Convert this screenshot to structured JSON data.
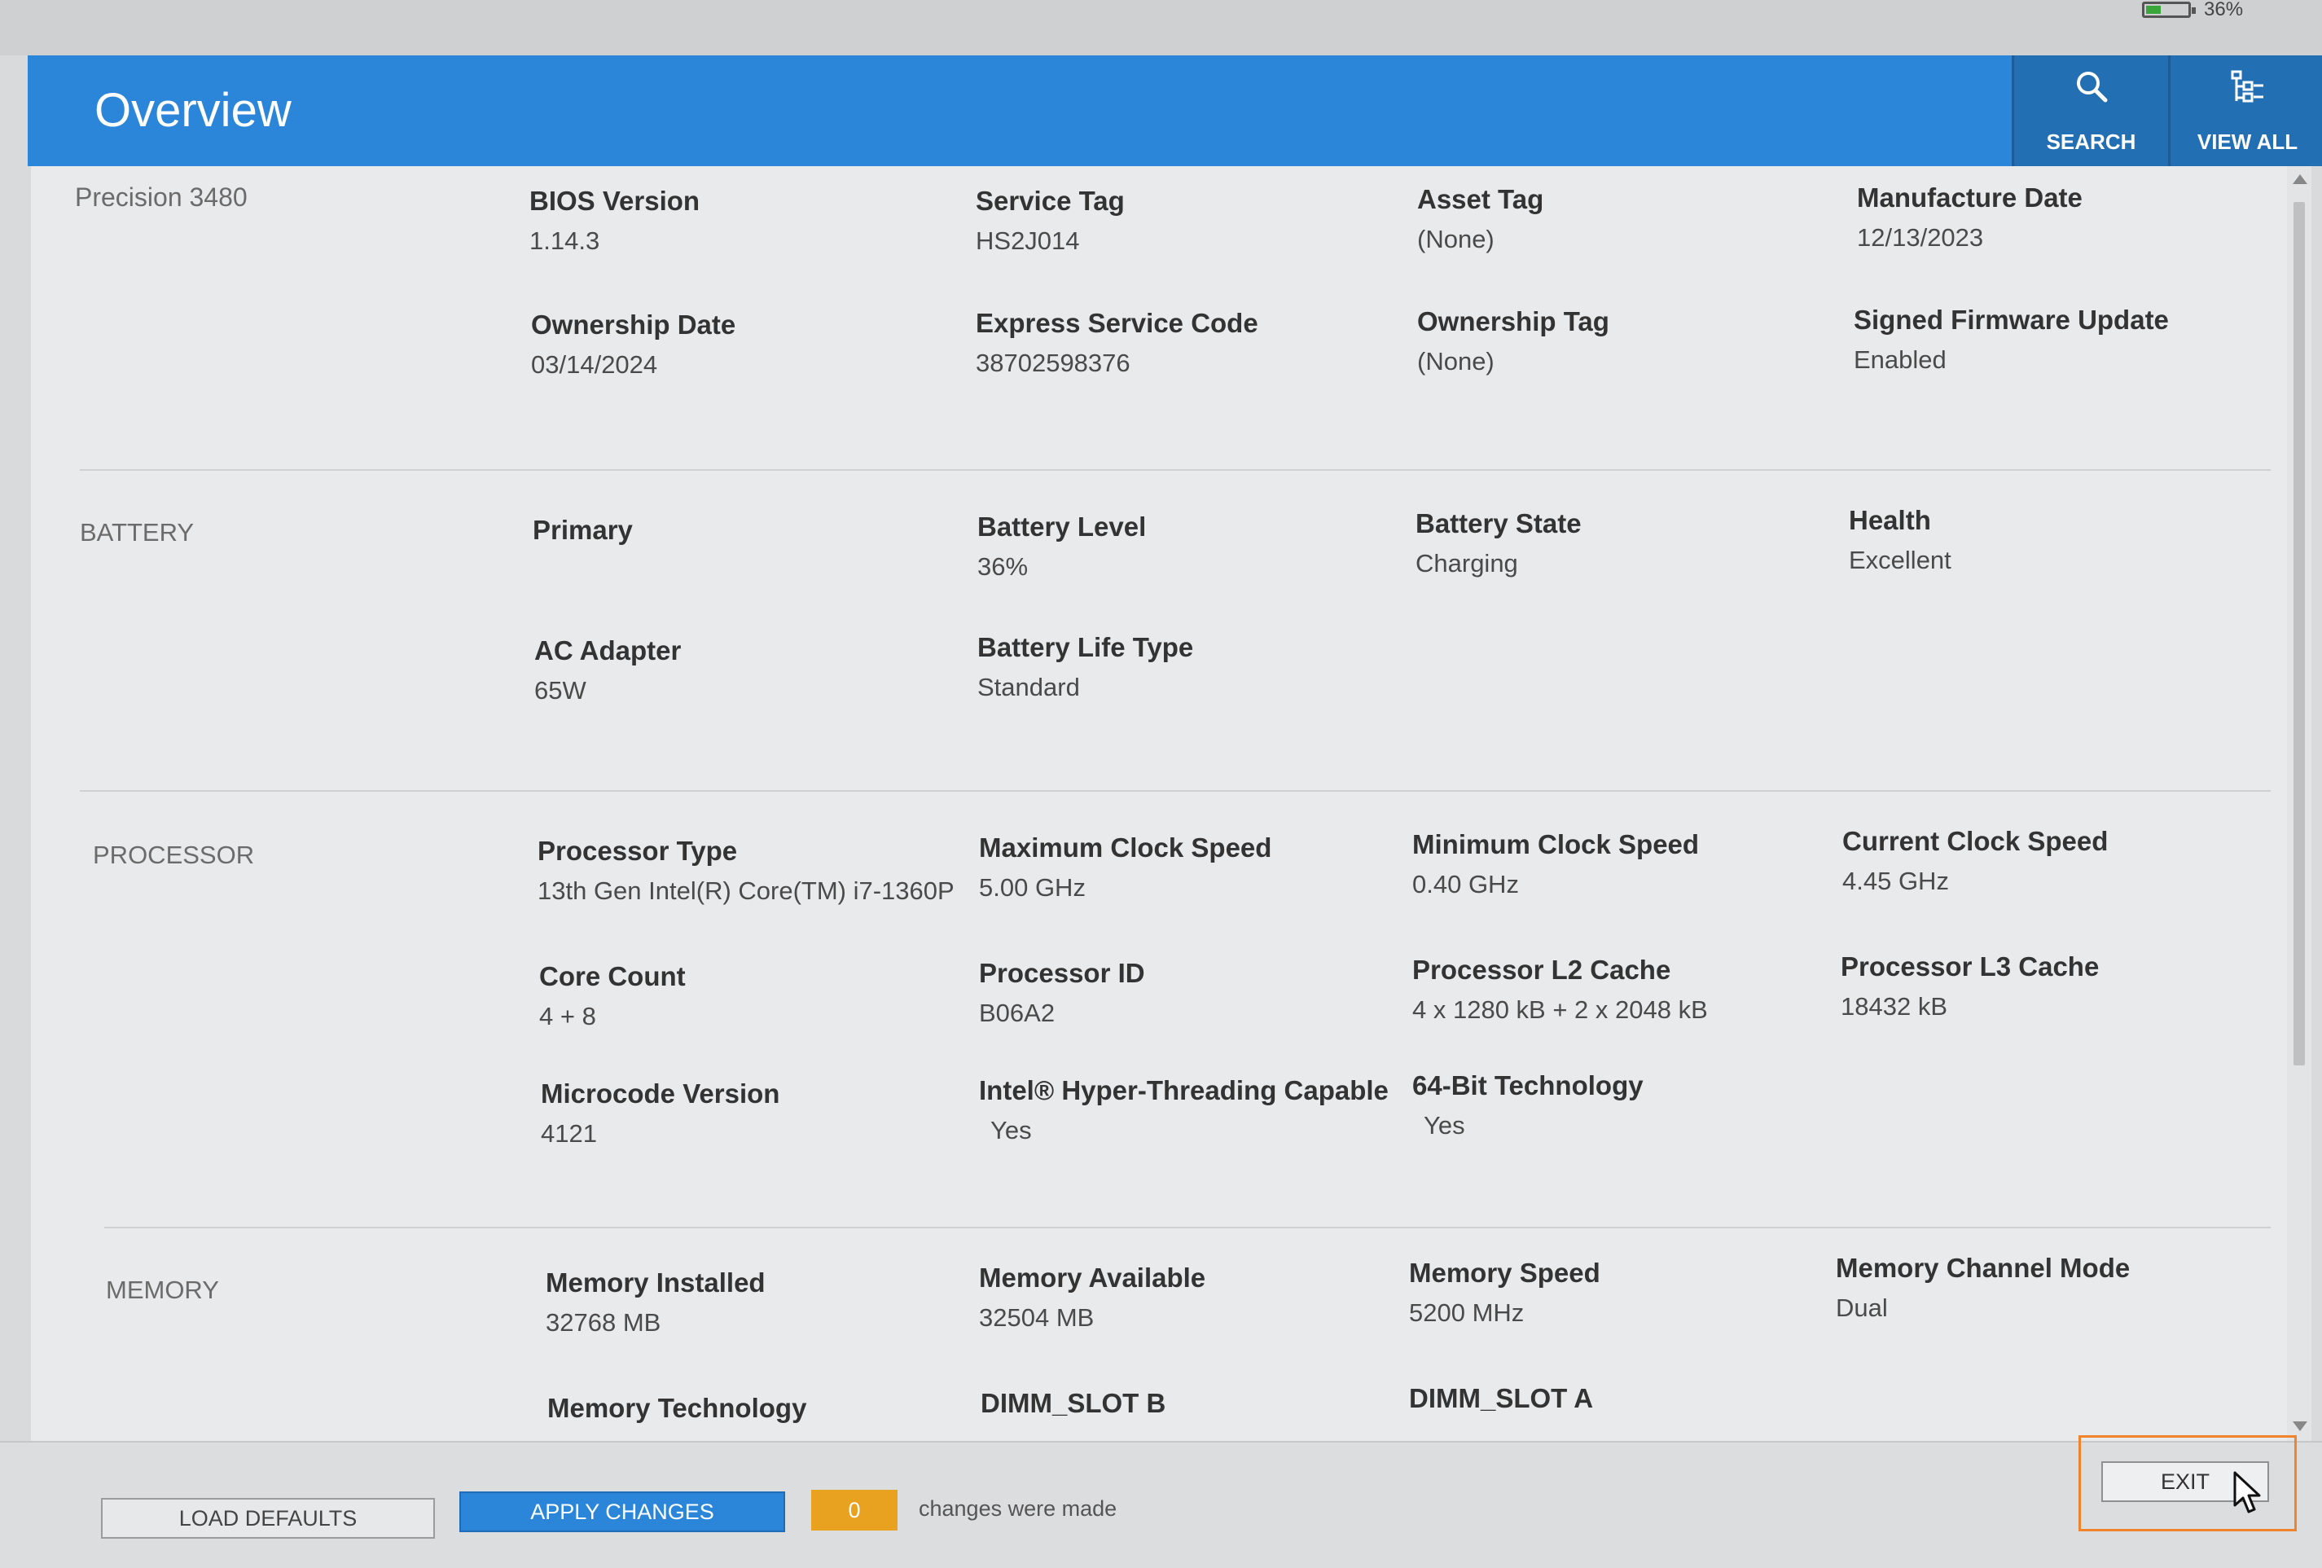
{
  "status": {
    "battery_percent": "36%",
    "battery_level": 0.36
  },
  "header": {
    "title": "Overview",
    "search_label": "SEARCH",
    "viewall_label": "VIEW ALL"
  },
  "system": {
    "model": "Precision 3480",
    "fields": [
      {
        "label": "BIOS Version",
        "value": "1.14.3"
      },
      {
        "label": "Service Tag",
        "value": "HS2J014"
      },
      {
        "label": "Asset Tag",
        "value": "(None)"
      },
      {
        "label": "Manufacture Date",
        "value": "12/13/2023"
      },
      {
        "label": "Ownership Date",
        "value": "03/14/2024"
      },
      {
        "label": "Express Service Code",
        "value": "38702598376"
      },
      {
        "label": "Ownership Tag",
        "value": "(None)"
      },
      {
        "label": "Signed Firmware Update",
        "value": "Enabled"
      }
    ]
  },
  "battery": {
    "section_label": "BATTERY",
    "fields": [
      {
        "label": "Primary",
        "value": ""
      },
      {
        "label": "Battery Level",
        "value": "36%"
      },
      {
        "label": "Battery State",
        "value": "Charging"
      },
      {
        "label": "Health",
        "value": "Excellent"
      },
      {
        "label": "AC Adapter",
        "value": "65W"
      },
      {
        "label": "Battery Life Type",
        "value": "Standard"
      }
    ]
  },
  "processor": {
    "section_label": "PROCESSOR",
    "fields": [
      {
        "label": "Processor Type",
        "value": "13th Gen Intel(R) Core(TM) i7-1360P"
      },
      {
        "label": "Maximum Clock Speed",
        "value": "5.00 GHz"
      },
      {
        "label": "Minimum Clock Speed",
        "value": "0.40 GHz"
      },
      {
        "label": "Current Clock Speed",
        "value": "4.45 GHz"
      },
      {
        "label": "Core Count",
        "value": "4 + 8"
      },
      {
        "label": "Processor ID",
        "value": "B06A2"
      },
      {
        "label": "Processor L2 Cache",
        "value": "4 x 1280  kB + 2 x 2048  kB"
      },
      {
        "label": "Processor L3 Cache",
        "value": "18432 kB"
      },
      {
        "label": "Microcode Version",
        "value": "4121"
      },
      {
        "label": "Intel® Hyper-Threading Capable",
        "value": "Yes"
      },
      {
        "label": "64-Bit Technology",
        "value": "Yes"
      }
    ]
  },
  "memory": {
    "section_label": "MEMORY",
    "fields": [
      {
        "label": "Memory Installed",
        "value": "32768 MB"
      },
      {
        "label": "Memory Available",
        "value": "32504 MB"
      },
      {
        "label": "Memory Speed",
        "value": "5200 MHz"
      },
      {
        "label": "Memory Channel Mode",
        "value": "Dual"
      },
      {
        "label": "Memory Technology",
        "value": ""
      },
      {
        "label": "DIMM_SLOT B",
        "value": ""
      },
      {
        "label": "DIMM_SLOT A",
        "value": ""
      }
    ]
  },
  "footer": {
    "load_defaults_label": "LOAD DEFAULTS",
    "apply_changes_label": "APPLY CHANGES",
    "changes_count": "0",
    "changes_text": "changes were made",
    "exit_label": "EXIT"
  }
}
